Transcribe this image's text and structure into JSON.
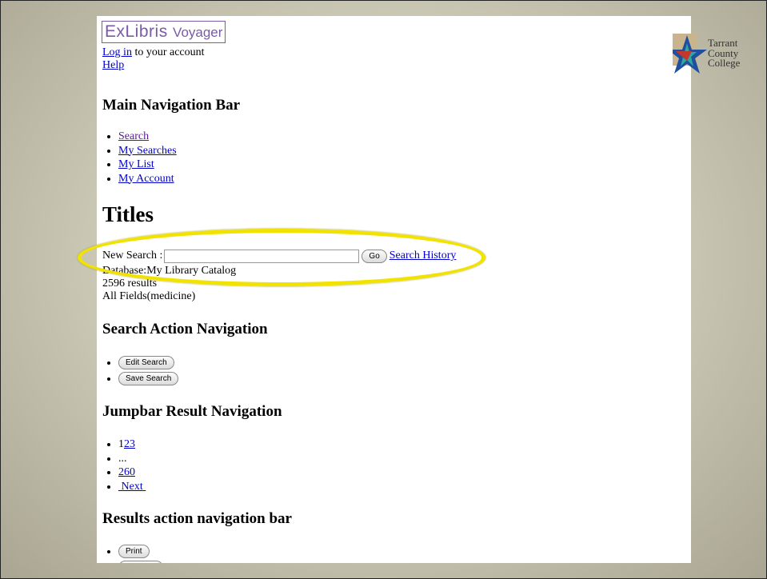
{
  "header": {
    "logo_main": "ExLibris",
    "logo_product": "Voyager",
    "login_link": "Log in",
    "login_rest": " to your account",
    "help_link": "Help"
  },
  "college": {
    "lines": [
      "Tarrant",
      "County",
      "College"
    ]
  },
  "main_nav": {
    "title": "Main Navigation Bar",
    "items": [
      "Search",
      "My Searches",
      "My List",
      "My Account"
    ]
  },
  "titles_heading": "Titles",
  "search": {
    "label": "New Search :",
    "value": "",
    "placeholder": "",
    "go_label": "Go",
    "history_link": "Search History"
  },
  "info": {
    "database": "Database:My Library Catalog",
    "results": "2596 results",
    "query": "All Fields(medicine)"
  },
  "search_action_nav": {
    "title": "Search Action Navigation",
    "buttons": [
      "Edit Search",
      "Save Search"
    ]
  },
  "jumpbar": {
    "title": "Jumpbar Result Navigation",
    "current_page": "1",
    "pages": [
      "2",
      "3"
    ],
    "ellipsis": "...",
    "last_page": "260",
    "next": "Next"
  },
  "results_action": {
    "title": "Results action navigation bar",
    "buttons": [
      "Print"
    ]
  },
  "colors": {
    "highlight": "#f2e200",
    "link": "#0000cc",
    "logo": "#7a5aa8"
  }
}
